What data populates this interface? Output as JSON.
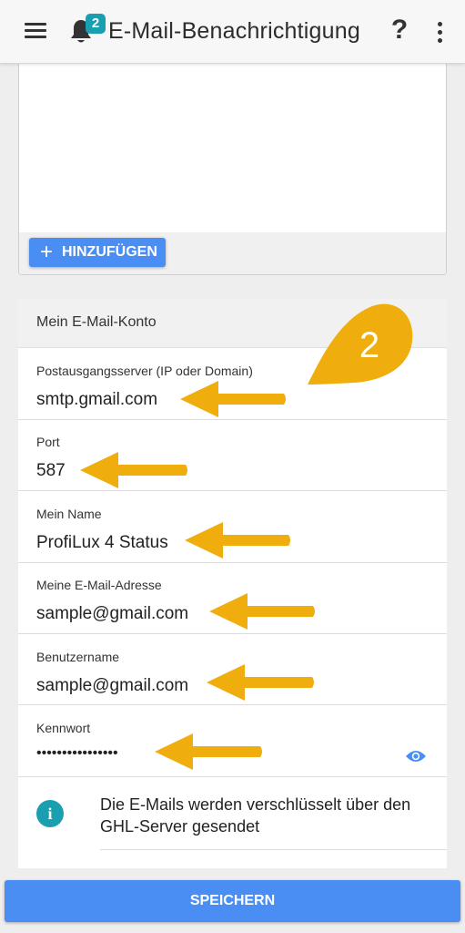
{
  "header": {
    "title": "E-Mail-Benachrichtigung",
    "badge": "2",
    "help_label": "?"
  },
  "recipients": {
    "add_label": "HINZUFÜGEN"
  },
  "account": {
    "section_title": "Mein E-Mail-Konto",
    "fields": [
      {
        "label": "Postausgangsserver (IP oder Domain)",
        "value": "smtp.gmail.com"
      },
      {
        "label": "Port",
        "value": "587"
      },
      {
        "label": "Mein Name",
        "value": "ProfiLux 4 Status"
      },
      {
        "label": "Meine E-Mail-Adresse",
        "value": "sample@gmail.com"
      },
      {
        "label": "Benutzername",
        "value": "sample@gmail.com"
      },
      {
        "label": "Kennwort",
        "value": "••••••••••••••••"
      }
    ],
    "info_text": "Die E-Mails werden verschlüsselt über den GHL-Server gesendet"
  },
  "annotation": {
    "step_number": "2",
    "color": "#f0ae0e"
  },
  "save_label": "SPEICHERN",
  "colors": {
    "accent": "#4a8ef3",
    "teal": "#1a9fb0"
  }
}
